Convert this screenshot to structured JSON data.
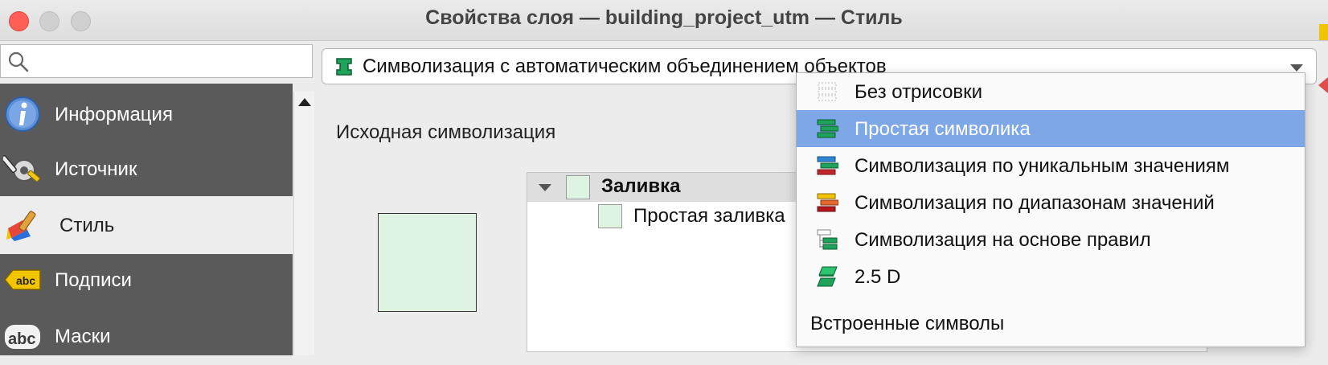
{
  "window": {
    "title": "Свойства слоя — building_project_utm — Стиль"
  },
  "search": {
    "placeholder": ""
  },
  "sidebar": {
    "items": [
      {
        "label": "Информация",
        "icon": "info-icon"
      },
      {
        "label": "Источник",
        "icon": "source-tools-icon"
      },
      {
        "label": "Стиль",
        "icon": "style-brush-icon",
        "active": true
      },
      {
        "label": "Подписи",
        "icon": "labels-abc-icon"
      },
      {
        "label": "Маски",
        "icon": "masks-abc-icon"
      }
    ]
  },
  "renderer_combo": {
    "selected": "Символизация с автоматическим объединением объектов"
  },
  "section": {
    "heading": "Исходная символизация"
  },
  "symbol_tree": {
    "root_label": "Заливка",
    "child_label": "Простая заливка"
  },
  "renderer_menu": {
    "items": [
      {
        "label": "Без отрисовки",
        "icon": "no-render-icon"
      },
      {
        "label": "Простая символика",
        "icon": "single-symbol-icon",
        "selected": true
      },
      {
        "label": "Символизация по уникальным значениям",
        "icon": "categorized-icon"
      },
      {
        "label": "Символизация по диапазонам значений",
        "icon": "graduated-icon"
      },
      {
        "label": "Символизация на основе правил",
        "icon": "rule-based-icon"
      },
      {
        "label": "2.5 D",
        "icon": "2-5d-icon"
      }
    ],
    "section_header": "Встроенные символы"
  },
  "colors": {
    "sidebar_bg": "#5a5a5a",
    "selection": "#7ea7e8",
    "fill_preview": "#dff3e3",
    "symbol_green": "#1fa35a"
  }
}
